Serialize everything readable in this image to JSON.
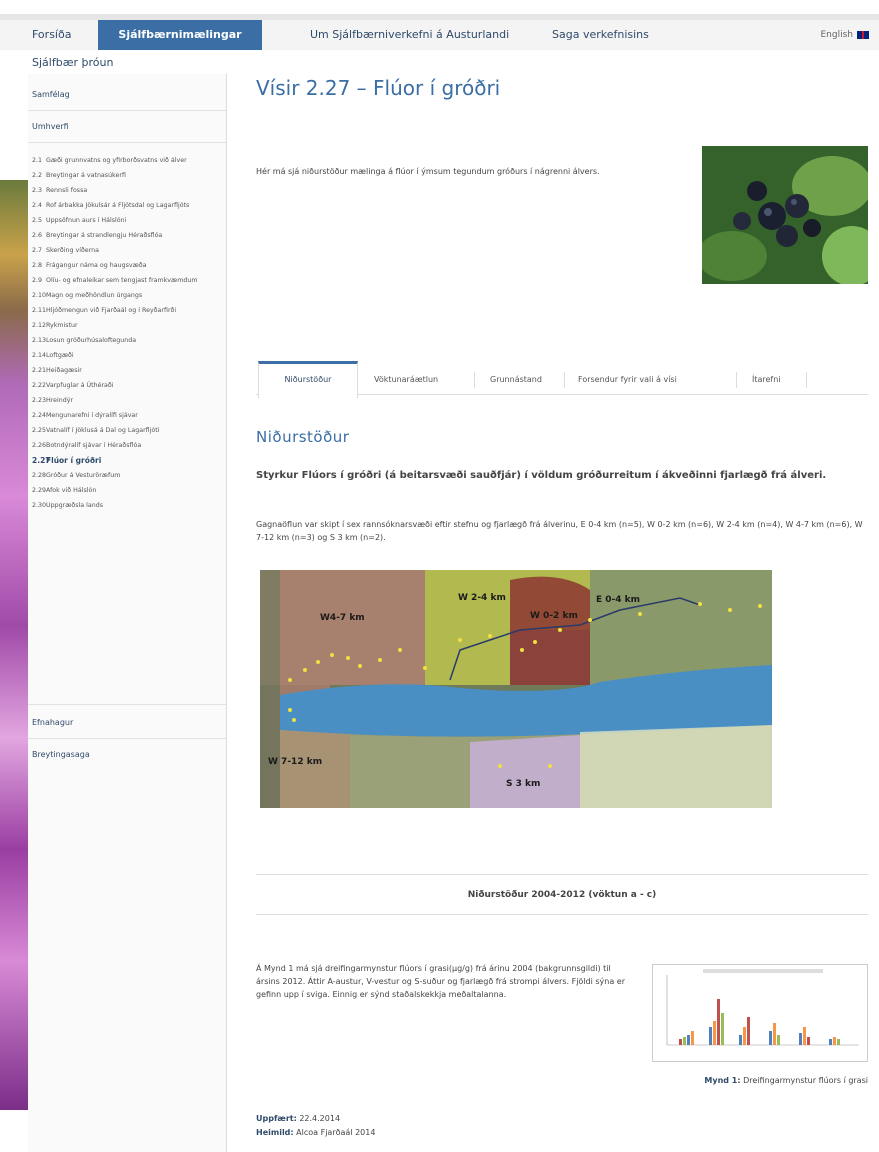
{
  "topnav": {
    "home": "Forsíða",
    "indicators": "Sjálfbærnimælingar",
    "project": "Um Sjálfbærniverkefni á Austurlandi",
    "history": "Saga verkefnisins",
    "english": "English"
  },
  "subnav": "Sjálfbær þróun",
  "sidebar": {
    "cat_society": "Samfélag",
    "cat_environment": "Umhverfi",
    "cat_economy": "Efnahagur",
    "cat_changelog": "Breytingasaga",
    "items": [
      {
        "num": "2.1",
        "label": "Gæði grunnvatns og yfirborðsvatns við álver"
      },
      {
        "num": "2.2",
        "label": "Breytingar á vatnasúkerfi"
      },
      {
        "num": "2.3",
        "label": "Rennsli fossa"
      },
      {
        "num": "2.4",
        "label": "Rof árbakka Jökulsár á Fljótsdal og Lagarfljóts"
      },
      {
        "num": "2.5",
        "label": "Uppsöfnun aurs í Hálslóni"
      },
      {
        "num": "2.6",
        "label": "Breytingar á strandlengju Héraðsflóa"
      },
      {
        "num": "2.7",
        "label": "Skerðing víðerna"
      },
      {
        "num": "2.8",
        "label": "Frágangur náma og haugsvæða"
      },
      {
        "num": "2.9",
        "label": "Olíu- og efnaleikar sem tengjast framkvæmdum"
      },
      {
        "num": "2.10",
        "label": "Magn og meðhöndlun úrgangs"
      },
      {
        "num": "2.11",
        "label": "Hljóðmengun við Fjarðaál og í Reyðarfirði"
      },
      {
        "num": "2.12",
        "label": "Rykmistur"
      },
      {
        "num": "2.13",
        "label": "Losun gróðurhúsaloftegunda"
      },
      {
        "num": "2.14",
        "label": "Loftgæði"
      },
      {
        "num": "2.21",
        "label": "Heiðagæsir"
      },
      {
        "num": "2.22",
        "label": "Varpfuglar á Úthéraði"
      },
      {
        "num": "2.23",
        "label": "Hreindýr"
      },
      {
        "num": "2.24",
        "label": "Mengunarefni í dýralífi sjávar"
      },
      {
        "num": "2.25",
        "label": "Vatnalíf í Jöklusá á Dal og Lagarfljóti"
      },
      {
        "num": "2.26",
        "label": "Botndýralíf sjávar í Héraðsflóa"
      },
      {
        "num": "2.27",
        "label": "Flúor í gróðri"
      },
      {
        "num": "2.28",
        "label": "Gróður á Vesturöræfum"
      },
      {
        "num": "2.29",
        "label": "Afok við Hálslón"
      },
      {
        "num": "2.30",
        "label": "Uppgræðsla lands"
      }
    ]
  },
  "main": {
    "title": "Vísir 2.27 – Flúor í gróðri",
    "intro": "Hér má sjá niðurstöður mælinga á flúor í ýmsum tegundum gróðurs í nágrenni álvers.",
    "tabs": [
      "Niðurstöður",
      "Vöktunaráætlun",
      "Grunnástand",
      "Forsendur fyrir vali á vísi",
      "Ítarefni"
    ],
    "section_title": "Niðurstöður",
    "subtitle": "Styrkur Flúors í gróðri (á beitarsvæði sauðfjár) í völdum gróðurreitum í ákveðinni fjarlægð frá álveri.",
    "desc": "Gagnaöflun var skipt í sex rannsóknarsvæði eftir stefnu og fjarlægð frá álverinu, E 0-4 km (n=5), W 0-2 km (n=6), W 2-4 km (n=4), W 4-7 km (n=6), W 7-12 km (n=3) og S 3 km (n=2).",
    "map_labels": {
      "w47": "W4-7 km",
      "w24": "W 2-4 km",
      "w02": "W 0-2 km",
      "e04": "E 0-4 km",
      "w712": "W 7-12 km",
      "s3": "S 3 km"
    },
    "results_title": "Niðurstöður 2004-2012 (vöktun a - c)",
    "fig_text": "Á Mynd 1 má sjá dreifingarmynstur flúors í grasi(µg/g) frá árinu 2004 (bakgrunnsgildi) til ársins 2012. Áttir A-austur, V-vestur og S-suður og fjarlægð frá strompi álvers. Fjöldi sýna er gefinn upp í sviga. Einnig er sýnd staðalskekkja meðaltalanna.",
    "caption_label": "Mynd 1:",
    "caption_text": " Dreifingarmynstur flúors í grasi",
    "updated_label": "Uppfært:",
    "updated_value": " 22.4.2014",
    "source_label": "Heimild:",
    "source_value": " Alcoa Fjarðaál 2014"
  },
  "colors": {
    "accent": "#3a6ea5",
    "nav_text": "#2f4a6a"
  }
}
